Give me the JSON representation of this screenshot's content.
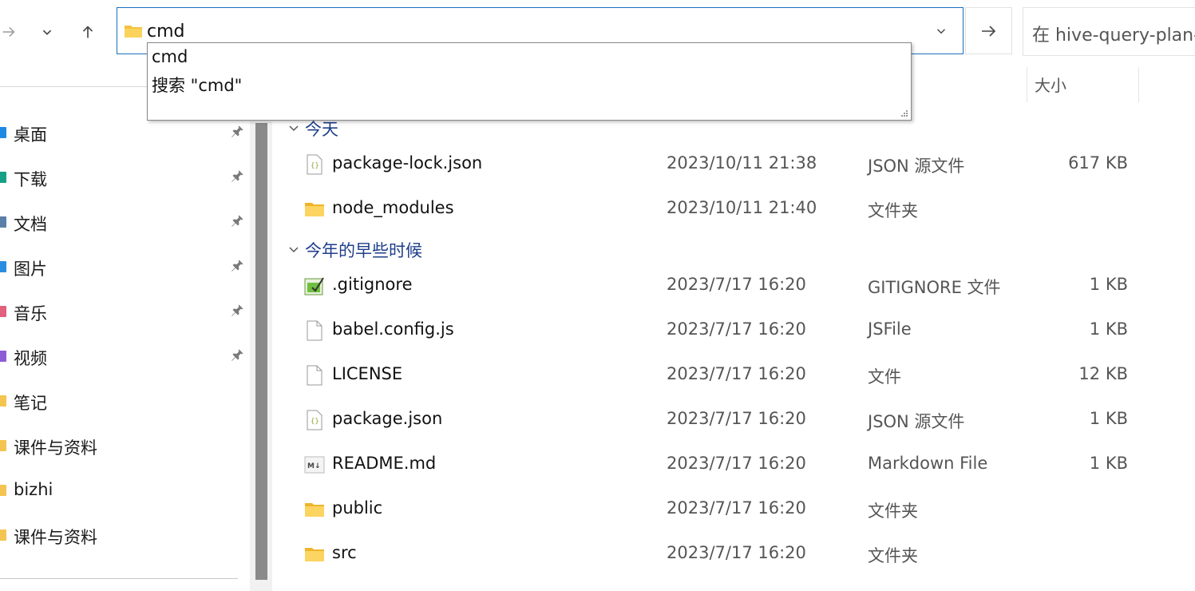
{
  "address_bar": {
    "value": "cmd"
  },
  "search": {
    "placeholder": "在 hive-query-plan-v"
  },
  "autocomplete": {
    "items": [
      "cmd",
      "搜索 \"cmd\""
    ]
  },
  "columns": {
    "size": "大小"
  },
  "sidebar": {
    "items": [
      {
        "label": "桌面",
        "pinned": true,
        "color": "#1e88e5"
      },
      {
        "label": "下载",
        "pinned": true,
        "color": "#16a085"
      },
      {
        "label": "文档",
        "pinned": true,
        "color": "#5b7fa8"
      },
      {
        "label": "图片",
        "pinned": true,
        "color": "#2a8de0"
      },
      {
        "label": "音乐",
        "pinned": true,
        "color": "#e0607e"
      },
      {
        "label": "视频",
        "pinned": true,
        "color": "#8e5bd6"
      },
      {
        "label": "笔记",
        "pinned": false,
        "color": "#f3c44f"
      },
      {
        "label": "课件与资料",
        "pinned": false,
        "color": "#f3c44f"
      },
      {
        "label": "bizhi",
        "pinned": false,
        "color": "#f3c44f"
      },
      {
        "label": "课件与资料",
        "pinned": false,
        "color": "#f3c44f"
      }
    ]
  },
  "groups": [
    {
      "label": "今天",
      "files": [
        {
          "name": "package-lock.json",
          "date": "2023/10/11 21:38",
          "type": "JSON 源文件",
          "size": "617 KB",
          "icon": "json-file-icon"
        },
        {
          "name": "node_modules",
          "date": "2023/10/11 21:40",
          "type": "文件夹",
          "size": "",
          "icon": "folder-icon"
        }
      ]
    },
    {
      "label": "今年的早些时候",
      "files": [
        {
          "name": ".gitignore",
          "date": "2023/7/17 16:20",
          "type": "GITIGNORE 文件",
          "size": "1 KB",
          "icon": "gitignore-file-icon"
        },
        {
          "name": "babel.config.js",
          "date": "2023/7/17 16:20",
          "type": "JSFile",
          "size": "1 KB",
          "icon": "blank-file-icon"
        },
        {
          "name": "LICENSE",
          "date": "2023/7/17 16:20",
          "type": "文件",
          "size": "12 KB",
          "icon": "blank-file-icon"
        },
        {
          "name": "package.json",
          "date": "2023/7/17 16:20",
          "type": "JSON 源文件",
          "size": "1 KB",
          "icon": "json-file-icon"
        },
        {
          "name": "README.md",
          "date": "2023/7/17 16:20",
          "type": "Markdown File",
          "size": "1 KB",
          "icon": "markdown-file-icon"
        },
        {
          "name": "public",
          "date": "2023/7/17 16:20",
          "type": "文件夹",
          "size": "",
          "icon": "folder-icon"
        },
        {
          "name": "src",
          "date": "2023/7/17 16:20",
          "type": "文件夹",
          "size": "",
          "icon": "folder-icon"
        }
      ]
    }
  ]
}
